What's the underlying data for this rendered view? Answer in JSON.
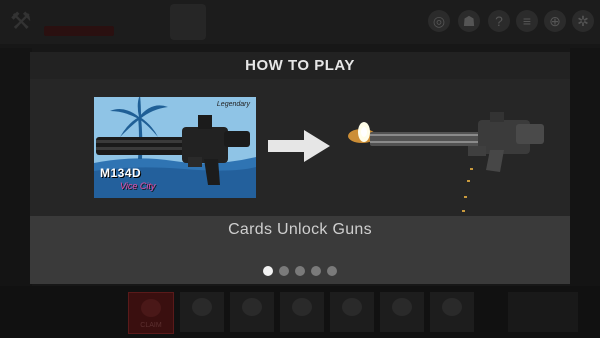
{
  "modal": {
    "title": "HOW TO PLAY",
    "caption": "Cards Unlock Guns",
    "page_count": 5,
    "active_page": 1
  },
  "card": {
    "logo_text": "M134D",
    "sub_text": "Vice City",
    "corner_text": "Legendary"
  },
  "background": {
    "bottom_tabs": [
      "CLAIM",
      "",
      "",
      "",
      "",
      "",
      ""
    ]
  },
  "colors": {
    "modal_header": "#222222",
    "modal_body": "#262626",
    "caption_band": "#3a3a3a",
    "card_sky": "#8fc4e6",
    "card_sea": "#2f74b3",
    "dot_active": "#f2f2f2",
    "dot_inactive": "#7a7a7a",
    "claim_tab": "#3a0f0f"
  },
  "icons": [
    "hammer-icon",
    "palm-tree-icon",
    "minigun-icon",
    "right-arrow-icon",
    "muzzle-flash-icon",
    "help-icon",
    "settings-icon",
    "globe-icon"
  ]
}
